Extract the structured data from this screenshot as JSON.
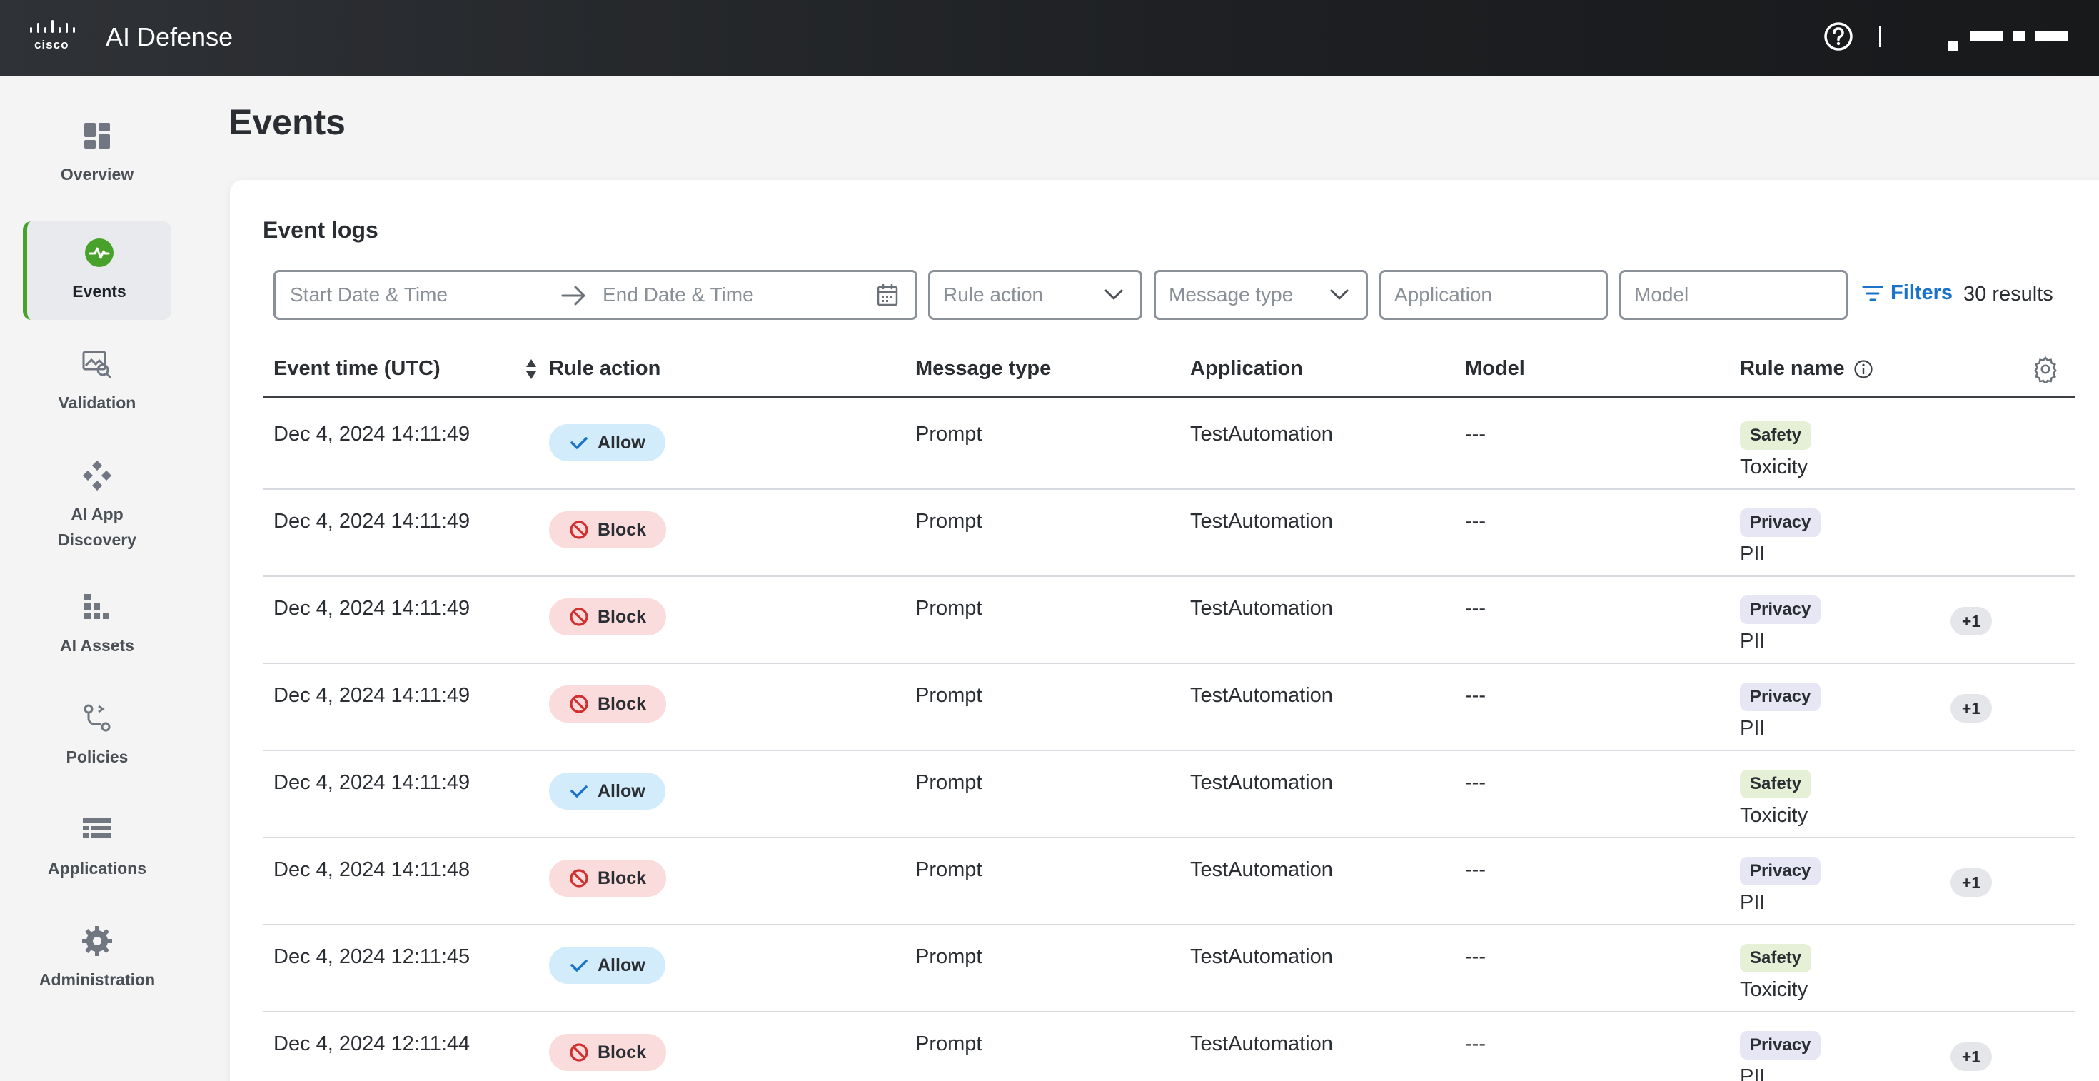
{
  "header": {
    "brand_logo": "cisco",
    "app_name": "AI Defense",
    "help_icon": "help-circle-icon"
  },
  "sidebar": {
    "items": [
      {
        "label": "Overview",
        "icon": "dashboard-icon"
      },
      {
        "label": "Events",
        "icon": "activity-pulse-icon",
        "active": true
      },
      {
        "label": "Validation",
        "icon": "image-search-icon"
      },
      {
        "label": "AI App Discovery",
        "icon": "discovery-nodes-icon"
      },
      {
        "label": "AI Assets",
        "icon": "assets-grid-icon"
      },
      {
        "label": "Policies",
        "icon": "policy-flow-icon"
      },
      {
        "label": "Applications",
        "icon": "applications-list-icon"
      },
      {
        "label": "Administration",
        "icon": "gear-icon"
      }
    ]
  },
  "page": {
    "title": "Events"
  },
  "event_logs": {
    "title": "Event logs",
    "filters": {
      "start_placeholder": "Start Date & Time",
      "end_placeholder": "End Date & Time",
      "rule_action_placeholder": "Rule action",
      "message_type_placeholder": "Message type",
      "application_placeholder": "Application",
      "model_placeholder": "Model",
      "filters_label": "Filters",
      "results_label": "30 results"
    },
    "columns": [
      "Event time (UTC)",
      "Rule action",
      "Message type",
      "Application",
      "Model",
      "Rule name"
    ],
    "rows": [
      {
        "time": "Dec 4, 2024 14:11:49",
        "action": "Allow",
        "message_type": "Prompt",
        "application": "TestAutomation",
        "model": "---",
        "category": "Safety",
        "rule": "Toxicity",
        "extra": ""
      },
      {
        "time": "Dec 4, 2024 14:11:49",
        "action": "Block",
        "message_type": "Prompt",
        "application": "TestAutomation",
        "model": "---",
        "category": "Privacy",
        "rule": "PII",
        "extra": ""
      },
      {
        "time": "Dec 4, 2024 14:11:49",
        "action": "Block",
        "message_type": "Prompt",
        "application": "TestAutomation",
        "model": "---",
        "category": "Privacy",
        "rule": "PII",
        "extra": "+1"
      },
      {
        "time": "Dec 4, 2024 14:11:49",
        "action": "Block",
        "message_type": "Prompt",
        "application": "TestAutomation",
        "model": "---",
        "category": "Privacy",
        "rule": "PII",
        "extra": "+1"
      },
      {
        "time": "Dec 4, 2024 14:11:49",
        "action": "Allow",
        "message_type": "Prompt",
        "application": "TestAutomation",
        "model": "---",
        "category": "Safety",
        "rule": "Toxicity",
        "extra": ""
      },
      {
        "time": "Dec 4, 2024 14:11:48",
        "action": "Block",
        "message_type": "Prompt",
        "application": "TestAutomation",
        "model": "---",
        "category": "Privacy",
        "rule": "PII",
        "extra": "+1"
      },
      {
        "time": "Dec 4, 2024 12:11:45",
        "action": "Allow",
        "message_type": "Prompt",
        "application": "TestAutomation",
        "model": "---",
        "category": "Safety",
        "rule": "Toxicity",
        "extra": ""
      },
      {
        "time": "Dec 4, 2024 12:11:44",
        "action": "Block",
        "message_type": "Prompt",
        "application": "TestAutomation",
        "model": "---",
        "category": "Privacy",
        "rule": "PII",
        "extra": "+1"
      }
    ]
  },
  "colors": {
    "accent": "#48a12a",
    "link": "#1a73c8",
    "allow_bg": "#d3ecfb",
    "block_bg": "#fbdcdc",
    "block_icon": "#d32f2f",
    "allow_icon": "#1a73c8",
    "safety_bg": "#e5f0d6",
    "privacy_bg": "#e6e6f5"
  }
}
